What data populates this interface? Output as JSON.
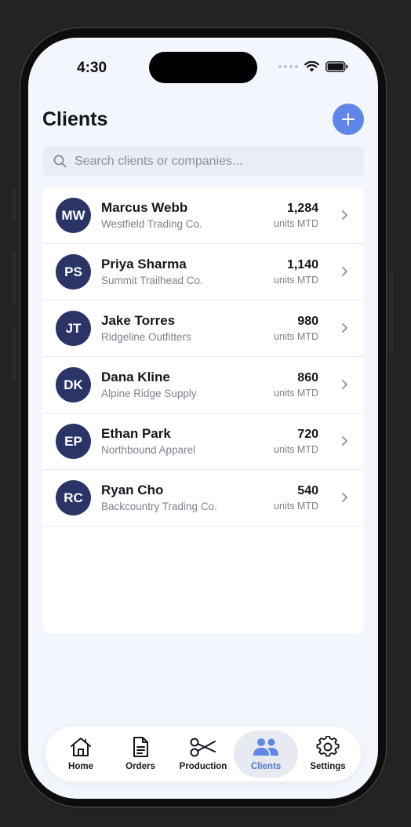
{
  "status_bar": {
    "time": "4:30"
  },
  "header": {
    "title": "Clients"
  },
  "search": {
    "placeholder": "Search clients or companies..."
  },
  "clients": [
    {
      "initials": "MW",
      "name": "Marcus Webb",
      "company": "Westfield Trading Co.",
      "units": "1,284",
      "units_label": "units MTD"
    },
    {
      "initials": "PS",
      "name": "Priya Sharma",
      "company": "Summit Trailhead Co.",
      "units": "1,140",
      "units_label": "units MTD"
    },
    {
      "initials": "JT",
      "name": "Jake Torres",
      "company": "Ridgeline Outfitters",
      "units": "980",
      "units_label": "units MTD"
    },
    {
      "initials": "DK",
      "name": "Dana Kline",
      "company": "Alpine Ridge Supply",
      "units": "860",
      "units_label": "units MTD"
    },
    {
      "initials": "EP",
      "name": "Ethan Park",
      "company": "Northbound Apparel",
      "units": "720",
      "units_label": "units MTD"
    },
    {
      "initials": "RC",
      "name": "Ryan Cho",
      "company": "Backcountry Trading Co.",
      "units": "540",
      "units_label": "units MTD"
    }
  ],
  "tabs": [
    {
      "label": "Home",
      "icon": "home-icon",
      "active": false
    },
    {
      "label": "Orders",
      "icon": "document-icon",
      "active": false
    },
    {
      "label": "Production",
      "icon": "scissors-icon",
      "active": false
    },
    {
      "label": "Clients",
      "icon": "users-icon",
      "active": true
    },
    {
      "label": "Settings",
      "icon": "gear-icon",
      "active": false
    }
  ],
  "colors": {
    "accent": "#5f86e8",
    "avatar": "#2b3467",
    "active_tab_text": "#4e78dc",
    "background": "#f3f6fd"
  }
}
